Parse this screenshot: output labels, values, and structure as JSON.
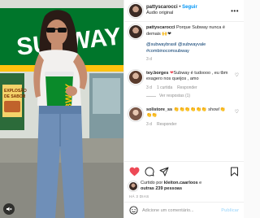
{
  "header": {
    "username": "pattyscarocci",
    "separator": " • ",
    "follow_label": "Seguir",
    "audio_label": "Áudio original",
    "more_label": "•••"
  },
  "caption": {
    "username": "pattyscarocci",
    "text": "Porque Subway nunca é demais",
    "emoji": "🙌❤",
    "mentions": "@subwaybrasil @subwayvale #combinocomsubway",
    "age": "3 d"
  },
  "comments": [
    {
      "username": "tey.borges",
      "text_emoji": "❤",
      "text": "Subway é tudoooo , eu tbm exagero nos queijos , amo",
      "age": "3 d",
      "likes": "1 curtida",
      "reply": "Responder",
      "view_replies": "Ver respostas (1)"
    },
    {
      "username": "solistore_ss",
      "text": "👏👏👏👏👏👏 show!👏👏👏",
      "age": "3 d",
      "reply": "Responder"
    }
  ],
  "likes": {
    "prefix": "Curtido por",
    "user": "kleiton.caarloos",
    "suffix_connector": "e",
    "others": "outras 239 pessoas"
  },
  "date": "HÁ 3 DIAS",
  "add_comment": {
    "placeholder": "Adicione um comentário...",
    "publish": "Publicar"
  },
  "photo": {
    "sign_text": "SUBWAY",
    "cup_text": "SUBWAY",
    "side_sign_1": "EXPLOSÃO",
    "side_sign_2": "DE SABOR"
  },
  "colors": {
    "accent": "#0095f6",
    "subway_green": "#008c15",
    "subway_yellow": "#ffc20e",
    "like_red": "#ed4956"
  }
}
